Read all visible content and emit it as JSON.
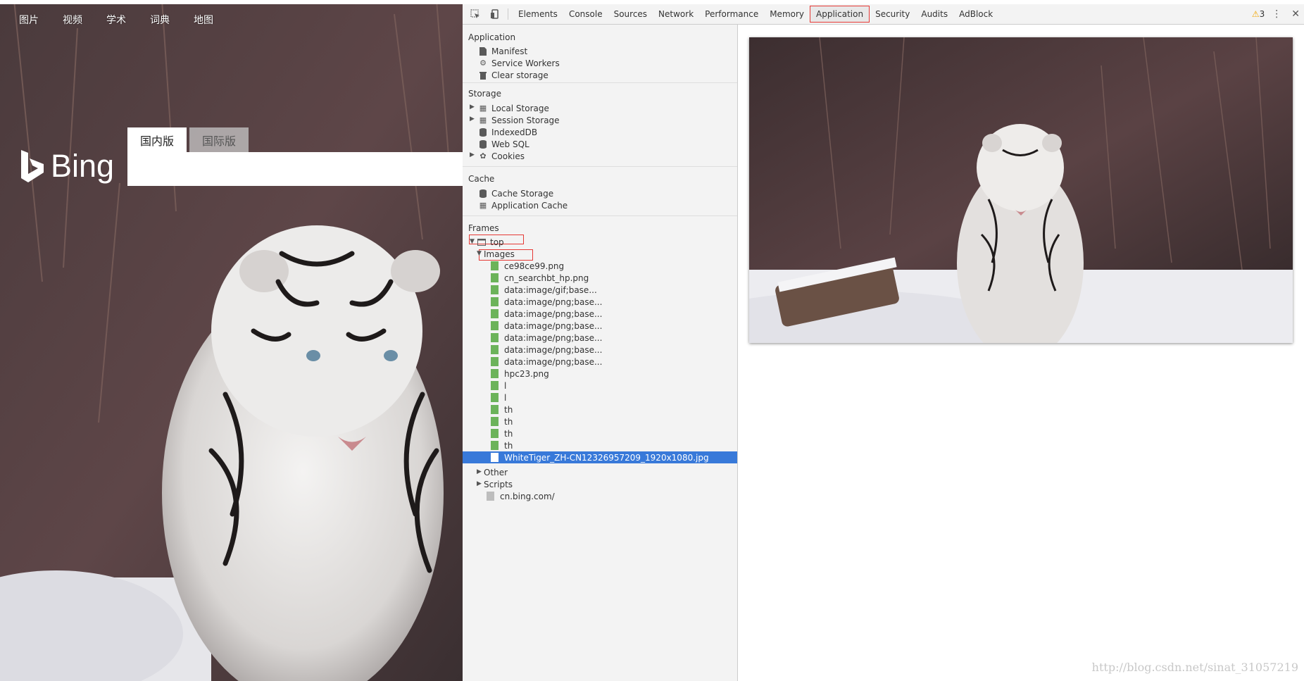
{
  "bing": {
    "nav": [
      "图片",
      "视频",
      "学术",
      "词典",
      "地图"
    ],
    "logo_text": "Bing",
    "tabs": {
      "domestic": "国内版",
      "international": "国际版"
    }
  },
  "devtools": {
    "tabs": [
      "Elements",
      "Console",
      "Sources",
      "Network",
      "Performance",
      "Memory",
      "Application",
      "Security",
      "Audits",
      "AdBlock"
    ],
    "selected_tab": "Application",
    "warning_count": "3",
    "sidebar": {
      "application": {
        "title": "Application",
        "items": [
          "Manifest",
          "Service Workers",
          "Clear storage"
        ]
      },
      "storage": {
        "title": "Storage",
        "items": [
          "Local Storage",
          "Session Storage",
          "IndexedDB",
          "Web SQL",
          "Cookies"
        ]
      },
      "cache": {
        "title": "Cache",
        "items": [
          "Cache Storage",
          "Application Cache"
        ]
      },
      "frames": {
        "title": "Frames",
        "top": "top",
        "images_label": "Images",
        "images": [
          "ce98ce99.png",
          "cn_searchbt_hp.png",
          "data:image/gif;base...",
          "data:image/png;base...",
          "data:image/png;base...",
          "data:image/png;base...",
          "data:image/png;base...",
          "data:image/png;base...",
          "data:image/png;base...",
          "hpc23.png",
          "l",
          "l",
          "th",
          "th",
          "th",
          "th",
          "WhiteTiger_ZH-CN12326957209_1920x1080.jpg"
        ],
        "other": "Other",
        "scripts": "Scripts",
        "document": "cn.bing.com/"
      }
    },
    "watermark": "http://blog.csdn.net/sinat_31057219"
  },
  "colors": {
    "selection": "#3879d9",
    "highlight_box": "#e53935",
    "file_icon": "#6cb35a"
  }
}
